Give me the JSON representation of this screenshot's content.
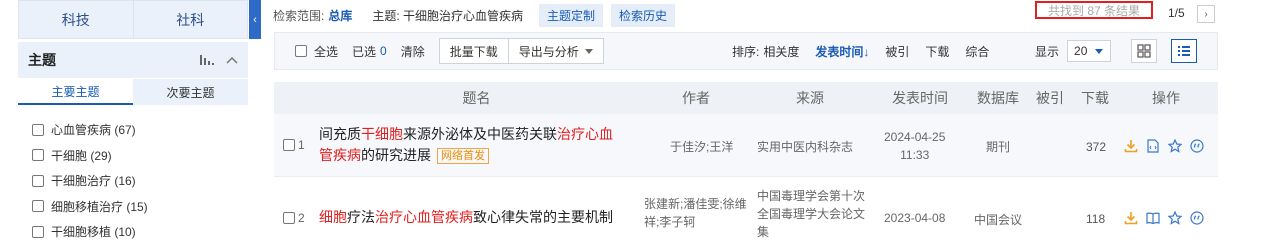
{
  "sidebar": {
    "tabs": [
      "科技",
      "社科"
    ],
    "section_title": "主题",
    "sub_tabs": [
      "主要主题",
      "次要主题"
    ],
    "facets": [
      "心血管疾病 (67)",
      "干细胞 (29)",
      "干细胞治疗 (16)",
      "细胞移植治疗 (15)",
      "干细胞移植 (10)"
    ],
    "collapse_arrow": "‹"
  },
  "search": {
    "scope_label": "检索范围:",
    "scope_value": "总库",
    "subject": "主题: 干细胞治疗心血管疾病",
    "custom_button": "主题定制",
    "history_button": "检索历史",
    "results_text": "共找到 87 条结果",
    "page_text": "1/5",
    "next_glyph": "›"
  },
  "toolbar": {
    "select_all": "全选",
    "selected_label": "已选",
    "selected_count": "0",
    "clear": "清除",
    "batch_download": "批量下载",
    "export": "导出与分析",
    "sort_label": "排序:",
    "sort_relevance": "相关度",
    "sort_time": "发表时间",
    "sort_time_arrow": "↓",
    "sort_cited": "被引",
    "sort_download": "下载",
    "sort_combined": "综合",
    "show_label": "显示",
    "page_size": "20"
  },
  "table": {
    "headers": [
      "题名",
      "作者",
      "来源",
      "发表时间",
      "数据库",
      "被引",
      "下载",
      "操作"
    ],
    "rows": [
      {
        "index": "1",
        "title_segments": [
          "间充质",
          "干细胞",
          "来源外泌体及中医药关联",
          "治疗心血",
          "管疾病",
          "的研究进展"
        ],
        "tag": "网络首发",
        "authors": "于佳汐;王洋",
        "source": "实用中医内科杂志",
        "date": "2024-04-25",
        "time": "11:33",
        "database": "期刊",
        "cited": "",
        "downloads": "372"
      },
      {
        "index": "2",
        "title_segments": [
          "细胞",
          "疗法",
          "治疗心血管疾病",
          "致心律失常的主要机制"
        ],
        "authors_line1": "张建新;潘佳雯;徐维",
        "authors_line2": "祥;李子轲",
        "source_line1": "中国毒理学会第十次",
        "source_line2": "全国毒理学大会论文",
        "source_line3": "集",
        "date": "2023-04-08",
        "database": "中国会议",
        "cited": "",
        "downloads": "118"
      }
    ]
  },
  "colors": {
    "accent": "#1a5bb5",
    "highlight": "#e02020",
    "download_icon": "#f0a020",
    "tag_orange": "#f08a00"
  }
}
